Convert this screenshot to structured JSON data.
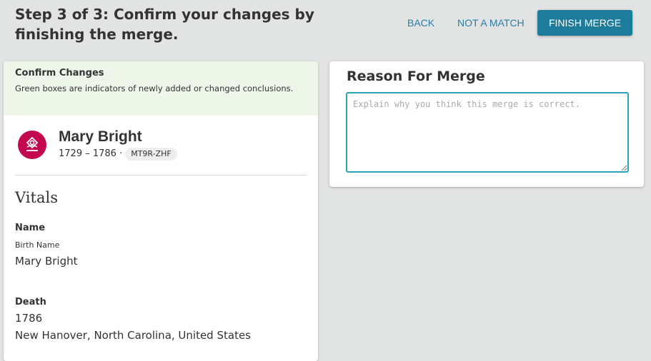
{
  "header": {
    "title": "Step 3 of 3: Confirm your changes by finishing the merge.",
    "back_label": "BACK",
    "not_match_label": "NOT A MATCH",
    "finish_label": "FINISH MERGE"
  },
  "confirm": {
    "title": "Confirm Changes",
    "description": "Green boxes are indicators of newly added or changed conclusions."
  },
  "person": {
    "name": "Mary Bright",
    "lifespan": "1729 – 1786 ·",
    "pid": "MT9R-ZHF",
    "avatar_icon": "female-person-icon",
    "avatar_color": "#c4084f"
  },
  "vitals": {
    "title": "Vitals",
    "name_label": "Name",
    "name_type": "Birth Name",
    "name_value": "Mary Bright",
    "death_label": "Death",
    "death_date": "1786",
    "death_place": "New Hanover, North Carolina, United States"
  },
  "reason": {
    "title": "Reason For Merge",
    "placeholder": "Explain why you think this merge is correct.",
    "value": ""
  },
  "colors": {
    "accent": "#1d7c9c",
    "link": "#2a7da6",
    "confirm_bg": "#eef6ea",
    "background": "#e2e3e3"
  }
}
